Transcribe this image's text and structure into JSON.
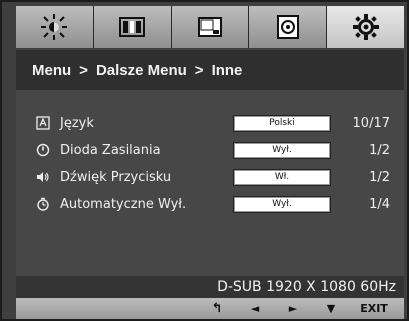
{
  "tabs": [
    {
      "icon": "brightness-icon",
      "active": false
    },
    {
      "icon": "color-bars-icon",
      "active": false
    },
    {
      "icon": "picture-icon",
      "active": false
    },
    {
      "icon": "disc-icon",
      "active": false
    },
    {
      "icon": "settings-gear-icon",
      "active": true
    }
  ],
  "breadcrumb": {
    "part1": "Menu",
    "sep1": ">",
    "part2": "Dalsze Menu",
    "sep2": ">",
    "part3": "Inne"
  },
  "rows": [
    {
      "icon": "language-icon",
      "label": "Język",
      "value": "Polski",
      "count": "10/17"
    },
    {
      "icon": "power-led-icon",
      "label": "Dioda Zasilania",
      "value": "Wył.",
      "count": "1/2"
    },
    {
      "icon": "speaker-icon",
      "label": "Dźwięk Przycisku",
      "value": "Wł.",
      "count": "1/2"
    },
    {
      "icon": "timer-icon",
      "label": "Automatyczne Wył.",
      "value": "Wył.",
      "count": "1/4"
    }
  ],
  "resolution": "D-SUB 1920 X 1080 60Hz",
  "keys": {
    "back": "↰",
    "left": "◄",
    "right": "►",
    "down": "▼",
    "exit": "EXIT"
  }
}
